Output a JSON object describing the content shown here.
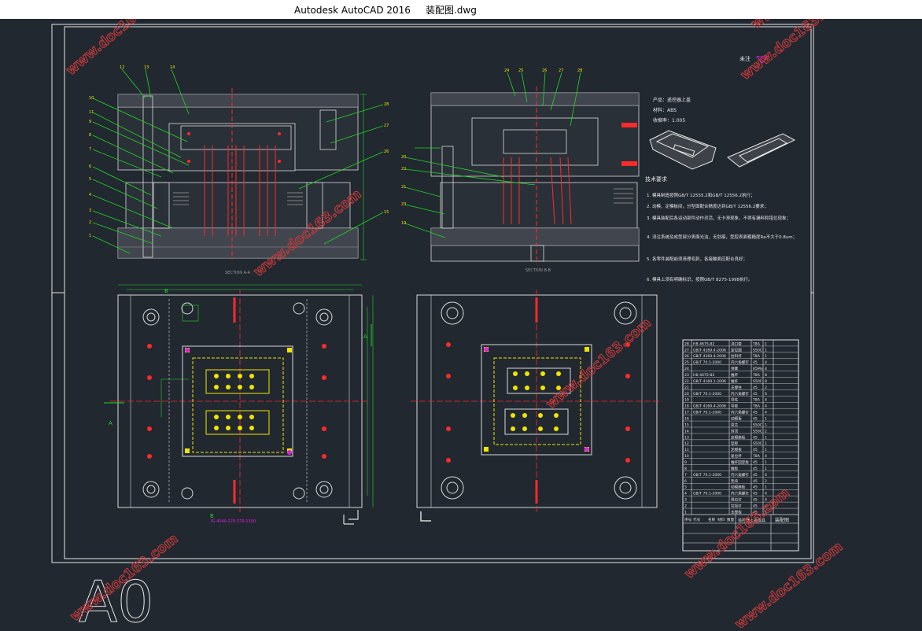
{
  "window": {
    "title": "Autodesk AutoCAD 2016     装配图.dwg"
  },
  "drawing": {
    "sheet_size_label": "A0",
    "section_a_label": "SECTION A-A",
    "section_b_label": "SECTION B-B",
    "tech_header": [
      "产品：遥控器上盖",
      "材料：ABS",
      "收缩率：1.005"
    ],
    "tech_requirements_title": "技术要求",
    "tech_requirements": [
      "1. 模具制造按照GB/T 12555.2和GB/T 12556.2执行；",
      "2. 动模、定模板间，分型面配合精度达到GB/T 12556.2要求；",
      "3. 模具装配后各运动部件动作灵活，无卡滞现象，不得有漏料和错位现象；",
      "4. 浇注系统及成型部分表面光洁，无划痕，型腔表面粗糙度Ra不大于0.8um；",
      "5. 各零件装配前须清理毛刺，各接触面应配合良好；",
      "6. 模具上须有明确标识，按照GB/T 8275-1998执行。"
    ],
    "section_marks": [
      "A",
      "A",
      "B",
      "B"
    ],
    "dim_label": "IG-4040-270-370-1300",
    "corner_note": "未注"
  },
  "watermark": {
    "text": "www.doc163.com"
  },
  "colors": {
    "background": "#212830",
    "frame": "#e6e6e6",
    "geometry": "#d9d9d9",
    "centerline": "#ff2a2a",
    "leader": "#22d622",
    "yellow": "#f0e400",
    "magenta": "#e020e0",
    "watermark": "#c83a3a"
  },
  "bom": {
    "rows": [
      [
        "28",
        "HB 4675-82",
        "浇口套",
        "T8A",
        "1"
      ],
      [
        "27",
        "GB/T 4169.4-2006",
        "定位圈",
        "S50C",
        "1"
      ],
      [
        "26",
        "GB/T 4169.4-2006",
        "拉料杆",
        "T8A",
        "1"
      ],
      [
        "25",
        "GB/T 70.1-2000",
        "内六角螺钉",
        "45",
        "4"
      ],
      [
        "24",
        "",
        "弹簧",
        "65Mn",
        "4"
      ],
      [
        "23",
        "HB 4675-82",
        "推杆",
        "T8A",
        "8"
      ],
      [
        "22",
        "GB/T 4169.1-2006",
        "推杆",
        "S50C",
        "8"
      ],
      [
        "21",
        "",
        "支撑柱",
        "45",
        "2"
      ],
      [
        "20",
        "GB/T 70.1-2000",
        "内六角螺钉",
        "45",
        "6"
      ],
      [
        "19",
        "",
        "导柱",
        "T8A",
        "4"
      ],
      [
        "18",
        "GB/T 4169.4-2006",
        "导套",
        "T8A",
        "4"
      ],
      [
        "17",
        "GB/T 70.1-2000",
        "内六角螺钉",
        "45",
        "4"
      ],
      [
        "16",
        "",
        "动模板",
        "45",
        "1"
      ],
      [
        "15",
        "",
        "型芯",
        "S50C",
        "1"
      ],
      [
        "14",
        "",
        "斜顶",
        "S50C",
        "2"
      ],
      [
        "13",
        "",
        "定模座板",
        "45",
        "1"
      ],
      [
        "12",
        "",
        "型腔",
        "S50C",
        "1"
      ],
      [
        "11",
        "",
        "定模板",
        "45",
        "1"
      ],
      [
        "10",
        "",
        "复位杆",
        "T8A",
        "4"
      ],
      [
        "9",
        "",
        "推杆固定板",
        "45",
        "1"
      ],
      [
        "8",
        "",
        "推板",
        "45",
        "1"
      ],
      [
        "7",
        "GB/T 70.1-2000",
        "内六角螺钉",
        "45",
        "4"
      ],
      [
        "6",
        "",
        "垫块",
        "45",
        "2"
      ],
      [
        "5",
        "",
        "动模座板",
        "45",
        "1"
      ],
      [
        "4",
        "GB/T 70.1-2000",
        "内六角螺钉",
        "45",
        "4"
      ],
      [
        "3",
        "",
        "限位钉",
        "45",
        "4"
      ],
      [
        "2",
        "",
        "垃圾钉",
        "45",
        "4"
      ],
      [
        "1",
        "",
        "支撑板",
        "45",
        "1"
      ]
    ],
    "header": [
      "序号",
      "代号",
      "名称",
      "材料",
      "数量"
    ],
    "title_block": {
      "name": "装配图",
      "drawing_title": "遥控器上盖模具"
    }
  }
}
